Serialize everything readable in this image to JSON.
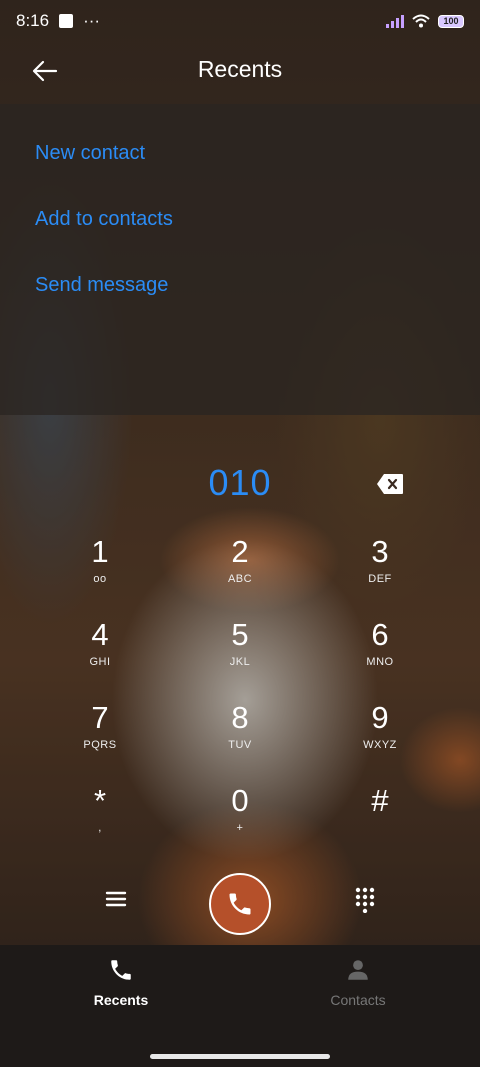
{
  "status_bar": {
    "time": "8:16",
    "more": "···",
    "battery": "100"
  },
  "header": {
    "title": "Recents"
  },
  "actions": {
    "new_contact": "New contact",
    "add_to_contacts": "Add to contacts",
    "send_message": "Send message"
  },
  "dialer": {
    "number": "010"
  },
  "keys": [
    {
      "digit": "1",
      "letters": "ᴏᴏ"
    },
    {
      "digit": "2",
      "letters": "ABC"
    },
    {
      "digit": "3",
      "letters": "DEF"
    },
    {
      "digit": "4",
      "letters": "GHI"
    },
    {
      "digit": "5",
      "letters": "JKL"
    },
    {
      "digit": "6",
      "letters": "MNO"
    },
    {
      "digit": "7",
      "letters": "PQRS"
    },
    {
      "digit": "8",
      "letters": "TUV"
    },
    {
      "digit": "9",
      "letters": "WXYZ"
    },
    {
      "digit": "*",
      "letters": ","
    },
    {
      "digit": "0",
      "letters": "+"
    },
    {
      "digit": "#",
      "letters": ""
    }
  ],
  "bottom_nav": {
    "recents": "Recents",
    "contacts": "Contacts"
  },
  "colors": {
    "accent": "#2b8cf5",
    "call_button": "#b5502a"
  }
}
